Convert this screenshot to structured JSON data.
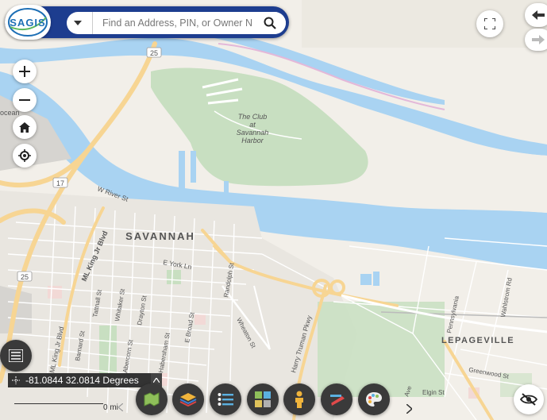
{
  "app": {
    "logo_text": "SAGIS"
  },
  "search": {
    "placeholder": "Find an Address, PIN, or Owner Na",
    "value": ""
  },
  "map": {
    "place_labels": {
      "city": "SAVANNAH",
      "neighborhood": "LEPAGEVILLE",
      "park_line1": "The Club",
      "park_line2": "at",
      "park_line3": "Savannah",
      "park_line4": "Harbor",
      "edge_label": "ocean"
    },
    "road_labels": {
      "river_st": "W River St",
      "mlk_blvd": "ML King Jr Blvd",
      "mlk_blvd_2": "ML King Jr Blvd",
      "york_ln": "E York Ln",
      "randolph": "Randolph St",
      "wheaton": "Wheaton St",
      "truman": "Harry Truman Pkwy",
      "broad": "E Broad St",
      "whitaker": "Whitaker St",
      "drayton": "Drayton St",
      "abercorn": "Abercorn St",
      "habersham": "Habersham St",
      "barnard": "Barnard St",
      "tattnall": "Tattnall St",
      "wahlstrom": "Wahlstrom Rd",
      "pennsylvania": "Pennsylvania",
      "greenwood": "Greenwood St",
      "elgin": "Elgin St",
      "ave": "Ave"
    },
    "shields": {
      "hwy25_north": "25",
      "hwy17": "17",
      "hwy25_south": "25"
    }
  },
  "coordinates": {
    "text": "-81.0844 32.0814 Degrees"
  },
  "scale": {
    "text": "0 mi"
  }
}
